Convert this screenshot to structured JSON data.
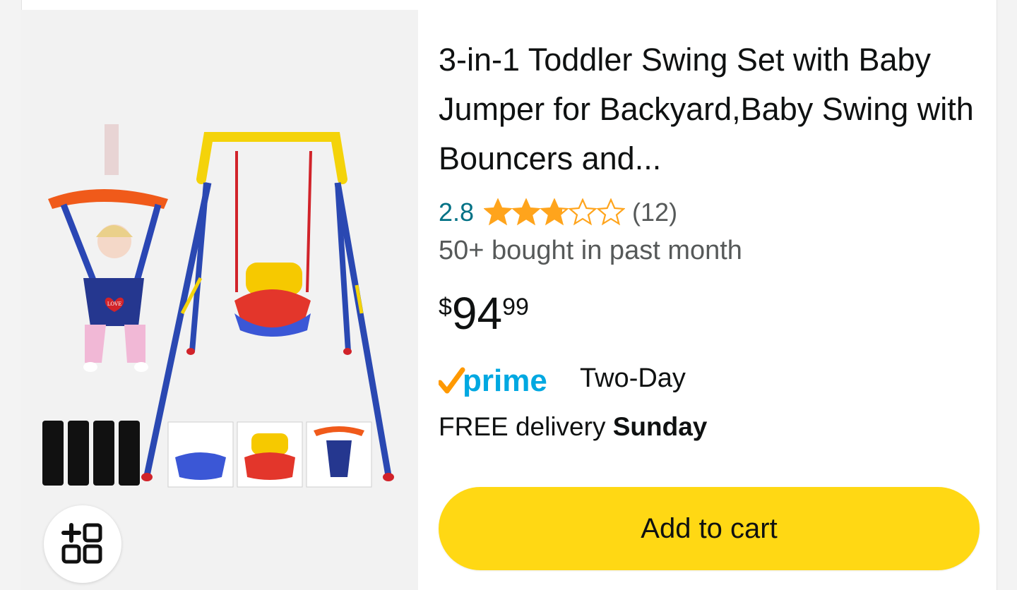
{
  "product": {
    "title": "3-in-1 Toddler Swing Set with Baby Jumper for Backyard,Baby Swing with Bouncers and...",
    "rating_value": "2.8",
    "rating": 2.8,
    "rating_max": 5,
    "review_count": "(12)",
    "bought_text": "50+ bought in past month",
    "price": {
      "symbol": "$",
      "whole": "94",
      "fraction": "99"
    },
    "prime_label": "prime",
    "prime_text": "Two-Day",
    "delivery_prefix": "FREE delivery",
    "delivery_day": "Sunday",
    "image_love_label": "LOVE"
  },
  "actions": {
    "add_to_cart": "Add to cart"
  },
  "icons": {
    "visual_search": "add-grid-icon",
    "stars": "star-icon",
    "prime_check": "prime-check-icon"
  },
  "colors": {
    "cart_button": "#ffd814",
    "rating_link": "#007185",
    "star_fill": "#ffa41c",
    "prime_blue": "#00a8e1",
    "prime_orange": "#ff9900"
  }
}
